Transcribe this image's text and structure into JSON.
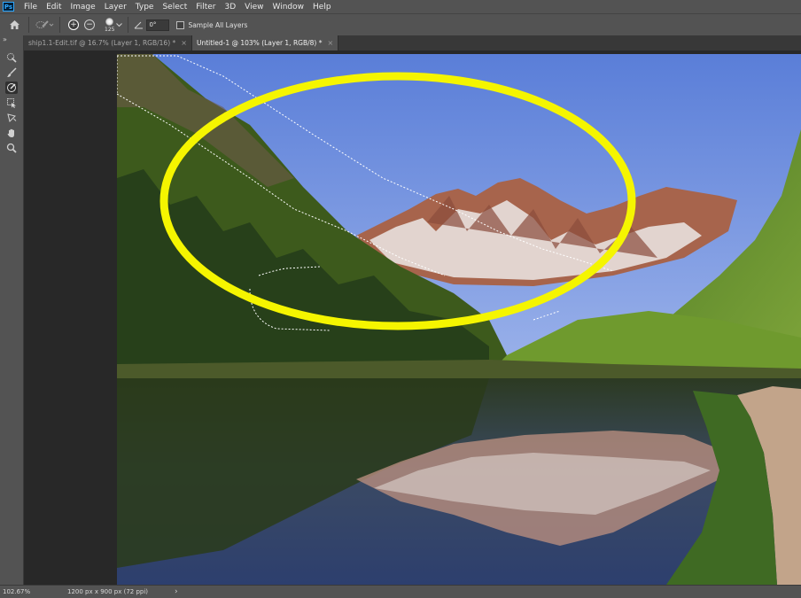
{
  "menubar": {
    "logo": "Ps",
    "items": [
      "File",
      "Edit",
      "Image",
      "Layer",
      "Type",
      "Select",
      "Filter",
      "3D",
      "View",
      "Window",
      "Help"
    ]
  },
  "options": {
    "add_symbol": "+",
    "subtract_symbol": "−",
    "brush_size": "125",
    "angle_value": "0°",
    "sample_all_layers": "Sample All Layers",
    "sample_all_checked": false
  },
  "tabs": [
    {
      "label": "ship1.1-Edit.tif @ 16.7% (Layer 1, RGB/16) *",
      "close": "×",
      "active": false
    },
    {
      "label": "Untitled-1 @ 103% (Layer 1, RGB/8) *",
      "close": "×",
      "active": true
    }
  ],
  "toolbar": {
    "collapse": "»",
    "tools": [
      "quick-selection-icon",
      "brush-icon",
      "refine-brush-icon",
      "object-selection-icon",
      "lasso-icon",
      "hand-icon",
      "zoom-icon"
    ],
    "active_tool": "refine-brush-icon"
  },
  "status": {
    "zoom": "102.67%",
    "doc_info": "1200 px x 900 px (72 ppi)",
    "arrow": "›"
  },
  "colors": {
    "annotation": "#f5f500",
    "panel": "#535353",
    "canvas_bg": "#282828"
  }
}
